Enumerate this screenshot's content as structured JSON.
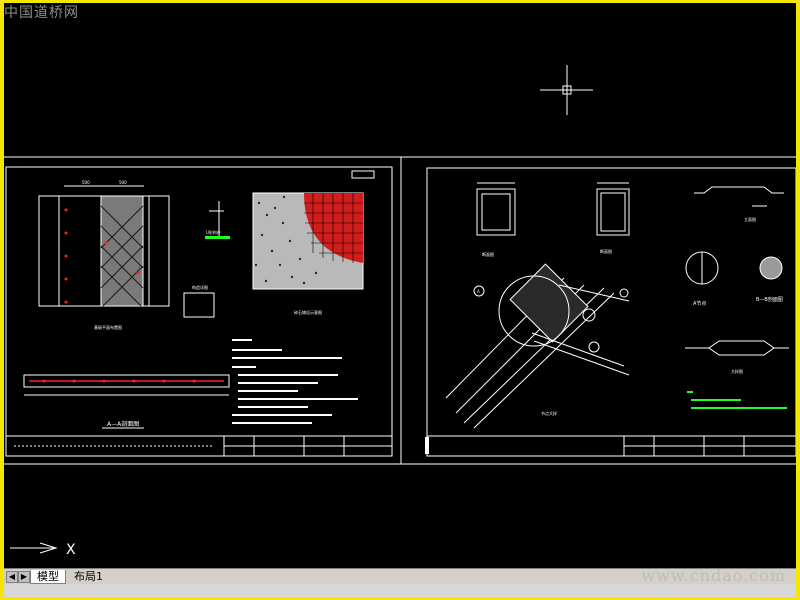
{
  "watermark": {
    "top_left": "中国道桥网",
    "bottom_right": "www.cndao.com"
  },
  "tabs": [
    {
      "label": "模型",
      "active": true
    },
    {
      "label": "布局1",
      "active": false
    }
  ],
  "ucs": {
    "x_label": "X"
  },
  "sheet_left": {
    "section_title": "A—A剖面图"
  },
  "sheet_right": {
    "label_a": "A",
    "label_b": "B",
    "section_bb": "B—B剖面图",
    "section_a": "A节点"
  },
  "colors": {
    "background": "#000000",
    "app_frame": "#f5e600",
    "sheet_border": "#ffffff",
    "accent_red": "#ff2020",
    "accent_green": "#20ff20"
  }
}
